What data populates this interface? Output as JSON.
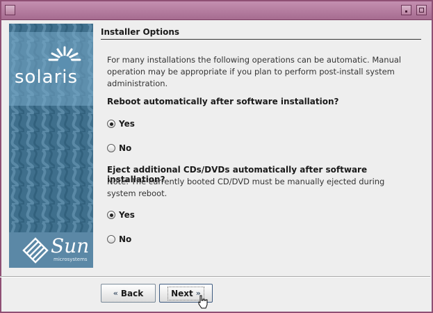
{
  "page": {
    "title": "Installer Options",
    "intro": "For many installations the following operations can be automatic.  Manual operation may be appropriate if you plan to perform post-install system administration."
  },
  "branding": {
    "solaris": "solaris",
    "sun": "Sun",
    "microsystems": "microsystems"
  },
  "reboot": {
    "question": "Reboot automatically after software installation?",
    "options": [
      {
        "label": "Yes",
        "selected": true
      },
      {
        "label": "No",
        "selected": false
      }
    ]
  },
  "eject": {
    "question": "Eject additional CDs/DVDs automatically after software installation?",
    "note": "Note: The currently booted CD/DVD must be manually ejected during system reboot.",
    "options": [
      {
        "label": "Yes",
        "selected": true
      },
      {
        "label": "No",
        "selected": false
      }
    ]
  },
  "buttons": {
    "back": "Back",
    "next": "Next"
  },
  "colors": {
    "titlebar": "#a66c90",
    "sidebar": "#3f6f8c",
    "background": "#eeeeee"
  }
}
